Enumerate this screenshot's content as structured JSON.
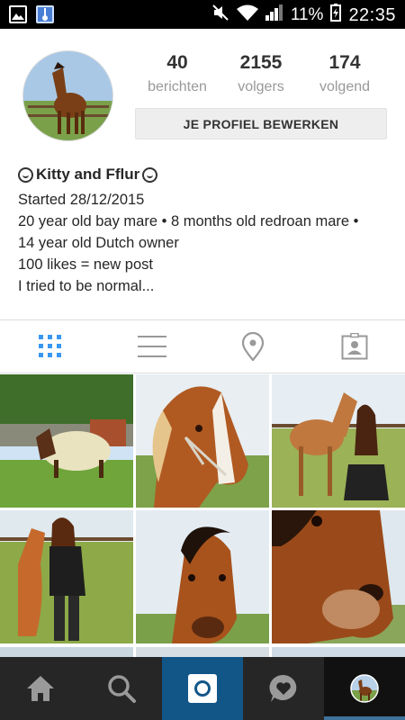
{
  "status_bar": {
    "battery": "11%",
    "time": "22:35"
  },
  "profile": {
    "stats": [
      {
        "value": "40",
        "label": "berichten"
      },
      {
        "value": "2155",
        "label": "volgers"
      },
      {
        "value": "174",
        "label": "volgend"
      }
    ],
    "edit_button": "JE PROFIEL BEWERKEN",
    "name": "Kitty and Fflur",
    "bio_lines": [
      "Started 28/12/2015",
      "20 year old bay mare • 8 months old redroan mare •",
      "14 year old Dutch owner",
      "100 likes = new post",
      "I tried to be normal..."
    ]
  },
  "tabs": [
    {
      "icon": "grid-icon",
      "active": true
    },
    {
      "icon": "list-icon",
      "active": false
    },
    {
      "icon": "location-pin-icon",
      "active": false
    },
    {
      "icon": "tagged-photos-icon",
      "active": false
    }
  ],
  "bottom_nav": [
    {
      "icon": "home-icon"
    },
    {
      "icon": "search-icon"
    },
    {
      "icon": "camera-icon"
    },
    {
      "icon": "activity-heart-icon"
    },
    {
      "icon": "profile-avatar-icon"
    }
  ],
  "colors": {
    "accent_blue": "#3897f0",
    "camera_blue": "#125688",
    "nav_dark": "#262626"
  }
}
